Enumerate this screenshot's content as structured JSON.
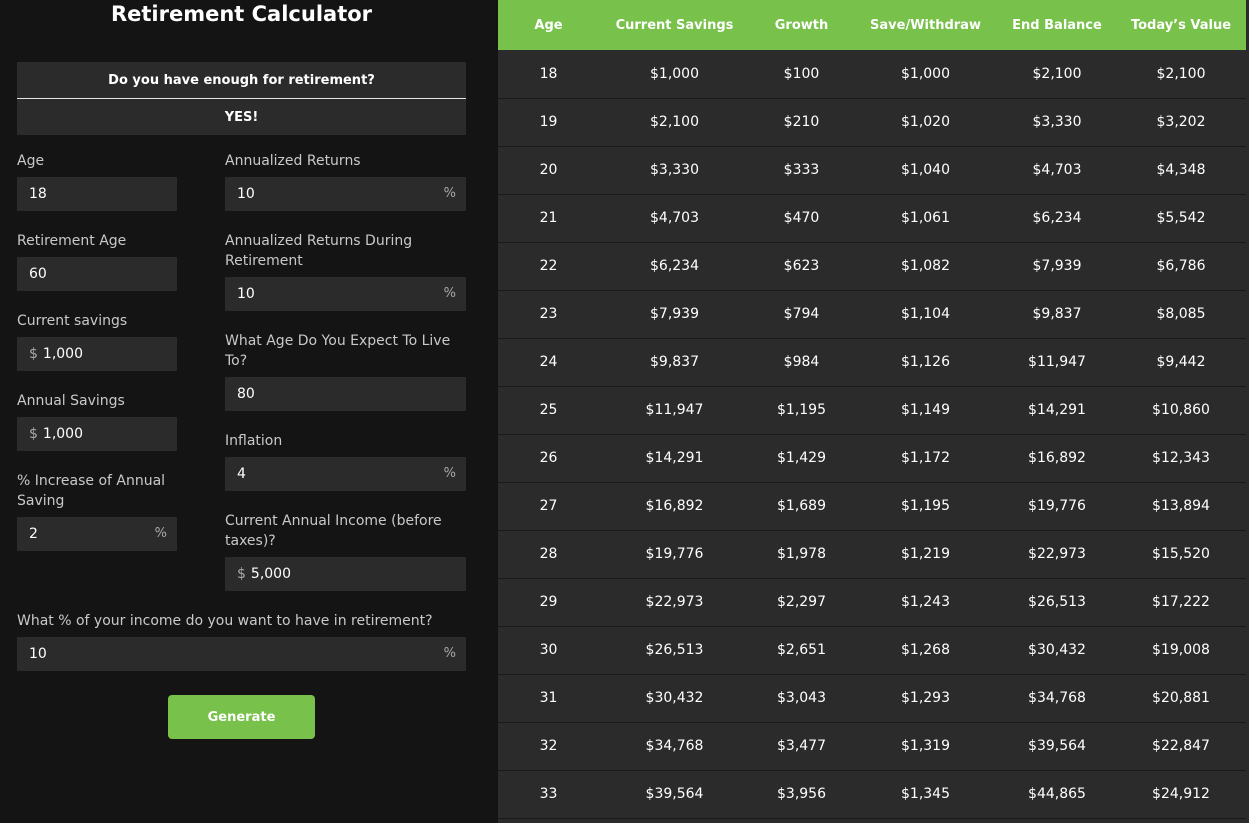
{
  "title": "Retirement Calculator",
  "enough": {
    "question": "Do you have enough for retirement?",
    "answer": "YES!"
  },
  "form": {
    "age": {
      "label": "Age",
      "value": "18"
    },
    "retirement_age": {
      "label": "Retirement Age",
      "value": "60"
    },
    "current_savings": {
      "label": "Current savings",
      "prefix": "$",
      "value": "1,000"
    },
    "annual_savings": {
      "label": "Annual Savings",
      "prefix": "$",
      "value": "1,000"
    },
    "increase_annual_saving": {
      "label": "% Increase of Annual Saving",
      "value": "2",
      "suffix": "%"
    },
    "annualized_returns": {
      "label": "Annualized Returns",
      "value": "10",
      "suffix": "%"
    },
    "returns_during_retirement": {
      "label": "Annualized Returns During Retirement",
      "value": "10",
      "suffix": "%"
    },
    "live_to_age": {
      "label": "What Age Do You Expect To Live To?",
      "value": "80"
    },
    "inflation": {
      "label": "Inflation",
      "value": "4",
      "suffix": "%"
    },
    "current_income": {
      "label": "Current Annual Income (before taxes)?",
      "prefix": "$",
      "value": "5,000"
    },
    "income_percent": {
      "label": "What % of your income do you want to have in retirement?",
      "value": "10",
      "suffix": "%"
    },
    "generate_label": "Generate"
  },
  "colors": {
    "accent": "#78c14a",
    "panel": "#2b2b2b",
    "background": "#141414"
  },
  "table": {
    "headers": [
      "Age",
      "Current Savings",
      "Growth",
      "Save/Withdraw",
      "End Balance",
      "Today’s Value"
    ],
    "rows": [
      [
        "18",
        "$1,000",
        "$100",
        "$1,000",
        "$2,100",
        "$2,100"
      ],
      [
        "19",
        "$2,100",
        "$210",
        "$1,020",
        "$3,330",
        "$3,202"
      ],
      [
        "20",
        "$3,330",
        "$333",
        "$1,040",
        "$4,703",
        "$4,348"
      ],
      [
        "21",
        "$4,703",
        "$470",
        "$1,061",
        "$6,234",
        "$5,542"
      ],
      [
        "22",
        "$6,234",
        "$623",
        "$1,082",
        "$7,939",
        "$6,786"
      ],
      [
        "23",
        "$7,939",
        "$794",
        "$1,104",
        "$9,837",
        "$8,085"
      ],
      [
        "24",
        "$9,837",
        "$984",
        "$1,126",
        "$11,947",
        "$9,442"
      ],
      [
        "25",
        "$11,947",
        "$1,195",
        "$1,149",
        "$14,291",
        "$10,860"
      ],
      [
        "26",
        "$14,291",
        "$1,429",
        "$1,172",
        "$16,892",
        "$12,343"
      ],
      [
        "27",
        "$16,892",
        "$1,689",
        "$1,195",
        "$19,776",
        "$13,894"
      ],
      [
        "28",
        "$19,776",
        "$1,978",
        "$1,219",
        "$22,973",
        "$15,520"
      ],
      [
        "29",
        "$22,973",
        "$2,297",
        "$1,243",
        "$26,513",
        "$17,222"
      ],
      [
        "30",
        "$26,513",
        "$2,651",
        "$1,268",
        "$30,432",
        "$19,008"
      ],
      [
        "31",
        "$30,432",
        "$3,043",
        "$1,293",
        "$34,768",
        "$20,881"
      ],
      [
        "32",
        "$34,768",
        "$3,477",
        "$1,319",
        "$39,564",
        "$22,847"
      ],
      [
        "33",
        "$39,564",
        "$3,956",
        "$1,345",
        "$44,865",
        "$24,912"
      ]
    ]
  }
}
